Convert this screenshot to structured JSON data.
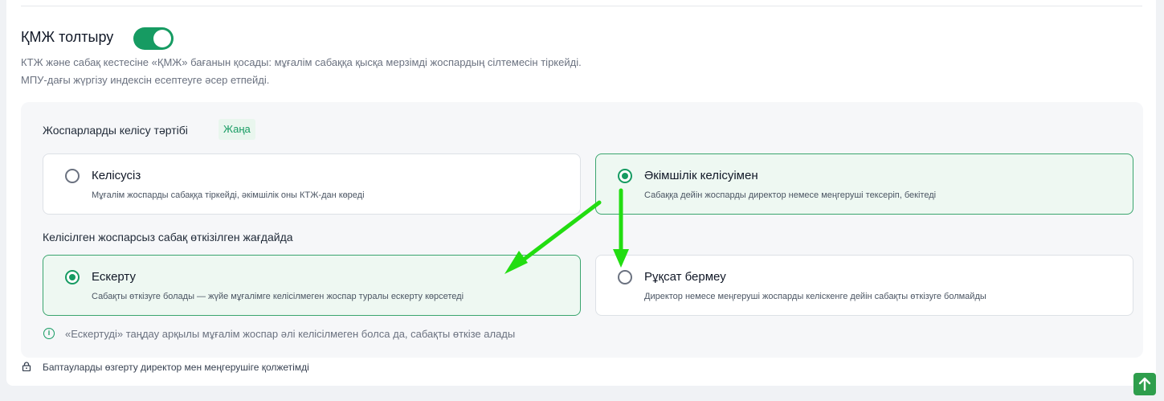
{
  "setting": {
    "title": "ҚМЖ толтыру",
    "enabled": true,
    "description_line1": "КТЖ және сабақ кестесіне «ҚМЖ» бағанын қосады: мұғалім сабаққа қысқа мерзімді жоспардың сілтемесін тіркейді.",
    "description_line2": "МПУ-дағы жүргізу индексін есептеуге әсер етпейді."
  },
  "approval": {
    "title": "Жоспарларды келісу тәртібі",
    "badge": "Жаңа",
    "options": [
      {
        "label": "Келісусіз",
        "description": "Мұғалім жоспарды сабаққа тіркейді, әкімшілік оны КТЖ-дан көреді",
        "selected": false
      },
      {
        "label": "Әкімшілік келісуімен",
        "description": "Сабаққа дейін жоспарды директор немесе меңгеруші тексеріп, бекітеді",
        "selected": true
      }
    ]
  },
  "unapproved": {
    "title": "Келісілген жоспарсыз сабақ өткізілген жағдайда",
    "options": [
      {
        "label": "Ескерту",
        "description": "Сабақты өткізуге болады — жүйе мұғалімге келісілмеген жоспар туралы ескерту көрсетеді",
        "selected": true
      },
      {
        "label": "Рұқсат бермеу",
        "description": "Директор немесе меңгеруші жоспарды келіскенге дейін сабақты өткізуге болмайды",
        "selected": false
      }
    ],
    "info": "«Ескертуді» таңдау арқылы мұғалім жоспар әлі келісілмеген болса да, сабақты өткізе алады"
  },
  "footer": {
    "access_note": "Баптауларды өзгерту директор мен меңгерушіге қолжетімді"
  },
  "colors": {
    "accent": "#169b62",
    "annotation_arrow": "#22dd11"
  },
  "icons": {
    "info": "info-icon",
    "lock": "lock-icon",
    "scroll_top": "arrow-up-icon"
  }
}
